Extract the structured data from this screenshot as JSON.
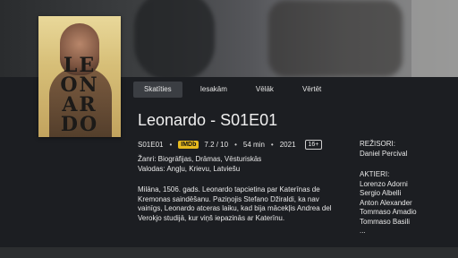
{
  "poster": {
    "title_lines": [
      "LE",
      "ON",
      "AR",
      "DO"
    ]
  },
  "tabs": [
    {
      "label": "Skatīties",
      "active": true
    },
    {
      "label": "Iesakām",
      "active": false
    },
    {
      "label": "Vēlāk",
      "active": false
    },
    {
      "label": "Vērtēt",
      "active": false
    }
  ],
  "title": "Leonardo - S01E01",
  "meta": {
    "episode": "S01E01",
    "imdb_badge": "IMDb",
    "rating": "7.2 / 10",
    "duration": "54 min",
    "year": "2021",
    "age_rating": "16+",
    "separator": "•"
  },
  "genres": "Žanri:  Biogrāfijas, Drāmas, Vēsturiskās",
  "languages": "Valodas:  Angļu, Krievu, Latviešu",
  "description": "Milāna, 1506. gads. Leonardo tapcietina par Katerīnas de Kremonas saindēšanu. Paziņojis Stefano Džiraldi, ka nav vainīgs, Leonardo atceras laiku, kad bija mācekļis Andrea del Verokjo studijā, kur viņš iepazinās ar Katerīnu.",
  "directors": {
    "heading": "REŽISORI:",
    "names": [
      "Daniel Percival"
    ]
  },
  "actors": {
    "heading": "AKTIERI:",
    "names": [
      "Lorenzo Adorni",
      "Sergio Albelli",
      "Anton Alexander",
      "Tommaso Amadio",
      "Tommaso Basili"
    ],
    "more": "..."
  }
}
